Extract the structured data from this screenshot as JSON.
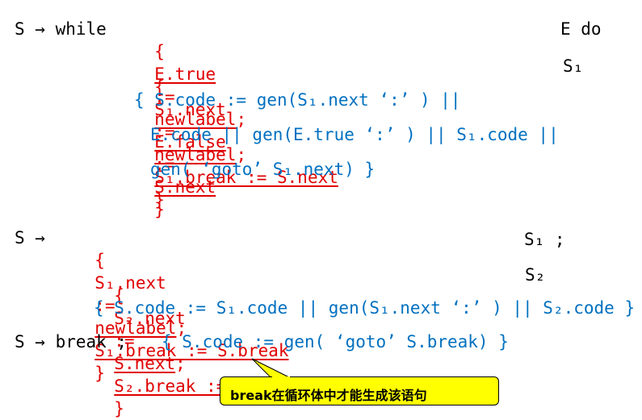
{
  "rule1": {
    "head": "S → while",
    "part1": {
      "open": "{",
      "t1": "E.true",
      "op1": ":=",
      "t2": "newlabel",
      "semi": ";",
      "t3": "E.false",
      "op2": ":=",
      "t4": "S.next",
      "close": "}"
    },
    "tail1": "E do",
    "part2": {
      "open": "{",
      "t1": "S₁.next",
      "op1": ":=",
      "t2": "newlabel",
      "semi": ";",
      "t3": "S₁.break := S.next",
      "close": "}"
    },
    "tail2": "S₁",
    "code1": "{ S.code := gen(S₁.next ‘:’ ) ||",
    "code2": "E.code || gen(E.true ‘:’ ) || S₁.code ||",
    "code3": "gen( ‘goto’ S₁.next) }"
  },
  "rule2": {
    "head": "S →",
    "p1": {
      "open": "{",
      "t1": "S₁.next",
      "op": ":=",
      "t2": "newlabel",
      "semi": ";",
      "t3": "S₁.break := S.break",
      "close": "}"
    },
    "tail1": "S₁ ;",
    "p2": {
      "open": "{",
      "t1": "S₂.next",
      "op": ":=",
      "t2": "S.next",
      "semi": ";",
      "t3": "S₂.break := S.break",
      "close": "}"
    },
    "tail2": "S₂",
    "code": "{ S.code := S₁.code || gen(S₁.next ‘:’ ) || S₂.code }"
  },
  "rule3": {
    "head": "S → break ;",
    "code": "{ S.code := gen( ‘goto’ S.break) }"
  },
  "callout": {
    "text": "break在循环体中才能生成该语句"
  },
  "colors": {
    "keyword": "#000000",
    "attr_red": "#e00000",
    "code_blue": "#0070c0",
    "callout_bg": "#ffff00"
  }
}
